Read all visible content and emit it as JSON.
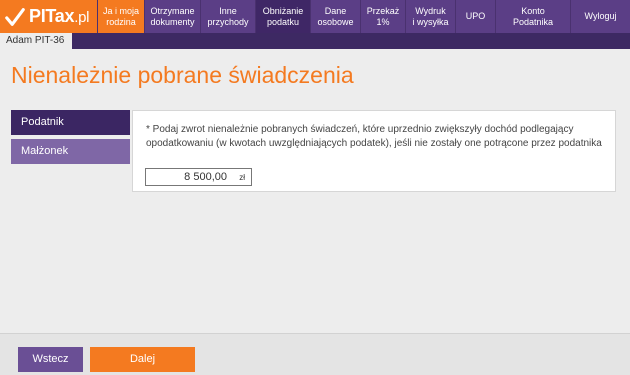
{
  "brand": {
    "name": "PITax",
    "suffix": ".pl"
  },
  "nav": {
    "items": [
      {
        "label": "Ja i moja\nrodzina",
        "state": "active"
      },
      {
        "label": "Otrzymane\ndokumenty",
        "state": "normal"
      },
      {
        "label": "Inne\nprzychody",
        "state": "normal"
      },
      {
        "label": "Obniżanie\npodatku",
        "state": "current"
      },
      {
        "label": "Dane\nosobowe",
        "state": "normal"
      },
      {
        "label": "Przekaż\n1%",
        "state": "normal"
      },
      {
        "label": "Wydruk\ni wysyłka",
        "state": "normal"
      },
      {
        "label": "UPO",
        "state": "normal"
      },
      {
        "label": "Konto\nPodatnika",
        "state": "normal"
      },
      {
        "label": "Wyloguj",
        "state": "normal"
      }
    ]
  },
  "subtab": {
    "label": "Adam PIT-36"
  },
  "page": {
    "title": "Nienależnie pobrane świadczenia"
  },
  "sidebar": {
    "items": [
      {
        "label": "Podatnik",
        "selected": true
      },
      {
        "label": "Małżonek",
        "selected": false
      }
    ]
  },
  "form": {
    "question": "* Podaj zwrot nienależnie pobranych świadczeń, które uprzednio zwiększyły dochód podlegający opodatkowaniu (w kwotach uwzględniających podatek), jeśli nie zostały one potrącone przez podatnika",
    "amount_value": "8 500,00",
    "amount_unit": "zł"
  },
  "footer": {
    "back_label": "Wstecz",
    "next_label": "Dalej"
  },
  "colors": {
    "accent_orange": "#f47a20",
    "nav_purple": "#5b3e86",
    "dark_purple": "#3b2663",
    "light_purple": "#7f67a6"
  }
}
